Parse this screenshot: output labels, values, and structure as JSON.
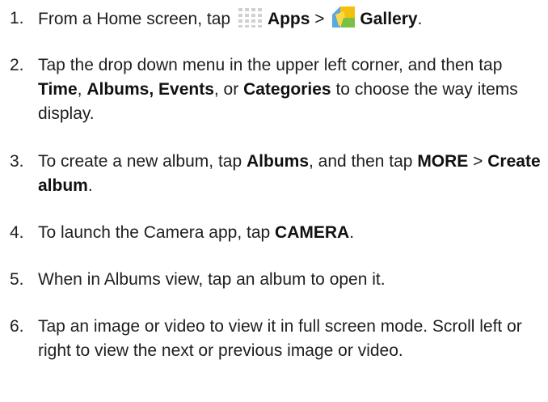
{
  "steps": [
    {
      "num": "1.",
      "t1": "From a Home screen, tap",
      "apps_icon": "apps-grid-icon",
      "b1": "Apps",
      "sep": ">",
      "gallery_icon": "gallery-icon",
      "b2": "Gallery",
      "end": "."
    },
    {
      "num": "2.",
      "t1": "Tap the drop down menu in the upper left corner, and then tap",
      "b1": "Time",
      "t2": ",",
      "b2": "Albums,",
      "b3": "Events",
      "t3": ", or",
      "b4": "Categories",
      "t4": "to choose the way items display."
    },
    {
      "num": "3.",
      "t1": "To create a new album, tap",
      "b1": "Albums",
      "t2": ", and then tap",
      "b2": "MORE",
      "sep": ">",
      "b3": "Create album",
      "end": "."
    },
    {
      "num": "4.",
      "t1": "To launch the Camera app, tap",
      "b1": "CAMERA",
      "end": "."
    },
    {
      "num": "5.",
      "t1": "When in Albums view, tap an album to open it."
    },
    {
      "num": "6.",
      "t1": "Tap an image or video to view it in full screen mode. Scroll left or right to view the next or previous image or video."
    }
  ],
  "colors": {
    "text": "#1e1e1e",
    "apps_icon": "#cfd0cf",
    "gallery_yellow": "#f2c10e",
    "gallery_blue": "#5aa8e0"
  }
}
